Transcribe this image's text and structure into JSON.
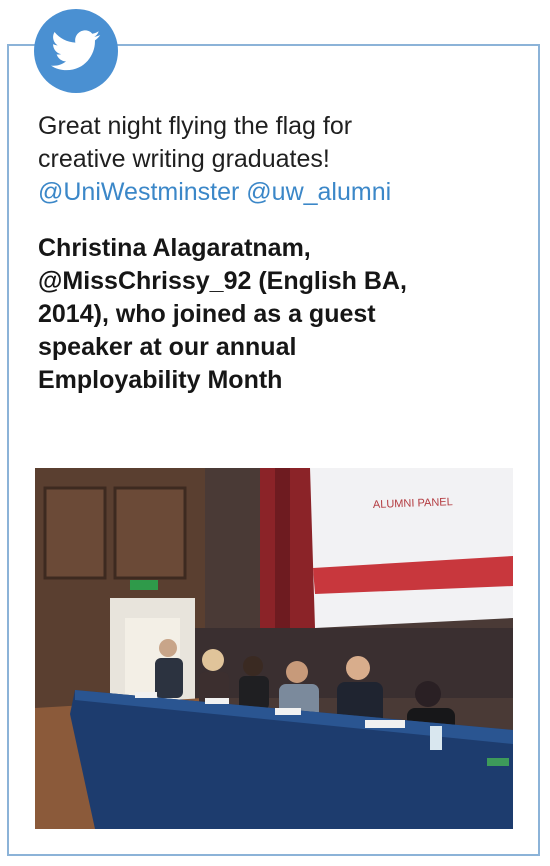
{
  "tweet": {
    "line1": "Great night flying the flag for",
    "line2": "creative writing graduates!",
    "handles": "@UniWestminster @uw_alumni"
  },
  "caption": {
    "line1": "Christina Alagaratnam,",
    "line2": "@MissChrissy_92 (English BA,",
    "line3": "2014), who joined as a guest",
    "line4": "speaker at our annual",
    "line5": "Employability Month"
  },
  "photo": {
    "screen_text": "ALUMNI PANEL"
  },
  "colors": {
    "twitter_blue": "#4a90d2",
    "border": "#8cb3d8",
    "link": "#3b87c8"
  },
  "icons": [
    "twitter-bird-icon"
  ]
}
